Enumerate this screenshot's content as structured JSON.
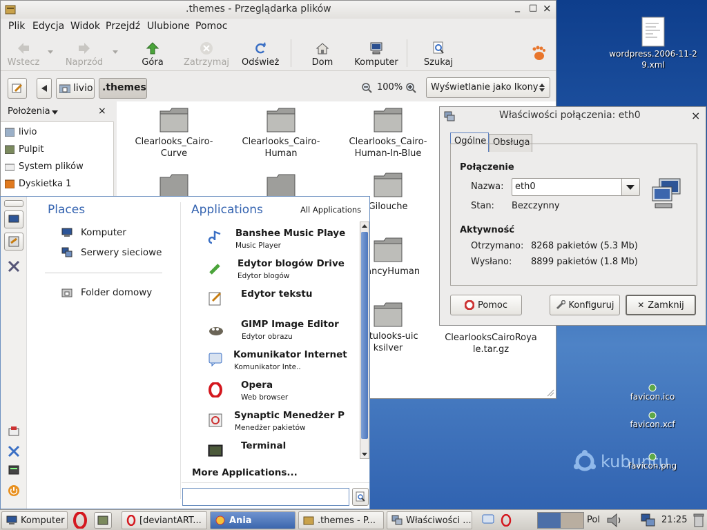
{
  "desktop": {
    "icons": [
      {
        "label": "wordpress.2006-11-29.xml"
      },
      {
        "label": "favicon.ico"
      },
      {
        "label": "favicon.xcf"
      },
      {
        "label": "favicon.png"
      }
    ],
    "wallpaper_logo": "kubuntu"
  },
  "file_manager": {
    "title": ".themes - Przeglądarka plików",
    "window_controls": [
      "_",
      "□",
      "×"
    ],
    "menu": [
      "Plik",
      "Edycja",
      "Widok",
      "Przejdź",
      "Ulubione",
      "Pomoc"
    ],
    "toolbar": {
      "back": "Wstecz",
      "forward": "Naprzód",
      "up": "Góra",
      "stop": "Zatrzymaj",
      "reload": "Odśwież",
      "home": "Dom",
      "computer": "Komputer",
      "search": "Szukaj"
    },
    "path": [
      "livio",
      ".themes"
    ],
    "zoom": "100%",
    "view_mode": "Wyświetlanie jako Ikony",
    "sidebar": {
      "title": "Położenia",
      "items": [
        "livio",
        "Pulpit",
        "System plików",
        "Dyskietka 1"
      ]
    },
    "files": [
      {
        "name": "Clearlooks_Cairo-Curve"
      },
      {
        "name": "Clearlooks_Cairo-Human"
      },
      {
        "name": "Clearlooks_Cairo-Human-In-Blue"
      },
      {
        "name": "Gilouche"
      },
      {
        "name": "aFancyHuman"
      },
      {
        "name": "untulooks-uicksilver"
      },
      {
        "name": "ClearlooksCairoRoyale.tar.gz"
      }
    ]
  },
  "dialog": {
    "title": "Właściwości połączenia: eth0",
    "tabs": [
      "Ogólne",
      "Obsługa"
    ],
    "connection_heading": "Połączenie",
    "name_label": "Nazwa:",
    "name_value": "eth0",
    "state_label": "Stan:",
    "state_value": "Bezczynny",
    "activity_heading": "Aktywność",
    "received_label": "Otrzymano:",
    "received_value": "8268 pakietów (5.3 Mb)",
    "sent_label": "Wysłano:",
    "sent_value": "8899 pakietów (1.8 Mb)",
    "help_button": "Pomoc",
    "configure_button": "Konfiguruj",
    "close_button": "Zamknij"
  },
  "kickoff": {
    "places_heading": "Places",
    "places": [
      "Komputer",
      "Serwery sieciowe",
      "Folder domowy"
    ],
    "apps_heading": "Applications",
    "all_apps": "All Applications",
    "apps": [
      {
        "name": "Banshee Music Playe",
        "sub": "Music Player"
      },
      {
        "name": "Edytor blogów Drive",
        "sub": "Edytor blogów"
      },
      {
        "name": "Edytor tekstu",
        "sub": ""
      },
      {
        "name": "GIMP Image Editor",
        "sub": "Edytor obrazu"
      },
      {
        "name": "Komunikator Internet",
        "sub": "Komunikator Inte.."
      },
      {
        "name": "Opera",
        "sub": "Web browser"
      },
      {
        "name": "Synaptic Menedżer P",
        "sub": "Menedżer pakietów"
      },
      {
        "name": "Terminal",
        "sub": ""
      }
    ],
    "more_apps": "More Applications...",
    "search_value": ""
  },
  "taskbar": {
    "start": "Komputer",
    "tasks": [
      "[deviantART...",
      "Ania",
      ".themes - P...",
      "Właściwości ..."
    ],
    "keyboard": "Pol",
    "clock": "21:25"
  }
}
